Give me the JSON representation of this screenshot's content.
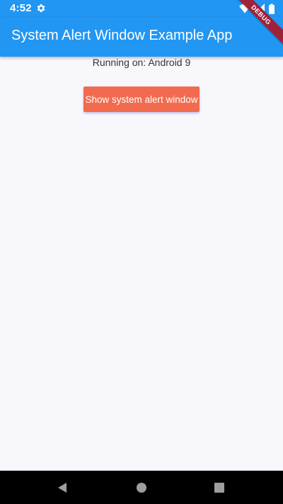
{
  "status_bar": {
    "time": "4:52",
    "icons": [
      "settings-gear-icon",
      "wifi-icon",
      "cell-signal-icon",
      "battery-icon"
    ]
  },
  "app_bar": {
    "title": "System Alert Window Example App",
    "debug_banner": "DEBUG"
  },
  "main": {
    "platform_text": "Running on: Android 9",
    "button_label": "Show system alert window"
  },
  "nav_bar": {
    "buttons": [
      "back-icon",
      "home-icon",
      "recents-icon"
    ]
  },
  "colors": {
    "primary": "#2196f3",
    "button": "#f26b4f",
    "background": "#f8f8fc",
    "debug_banner": "#a0213a",
    "nav_bar": "#000000"
  }
}
